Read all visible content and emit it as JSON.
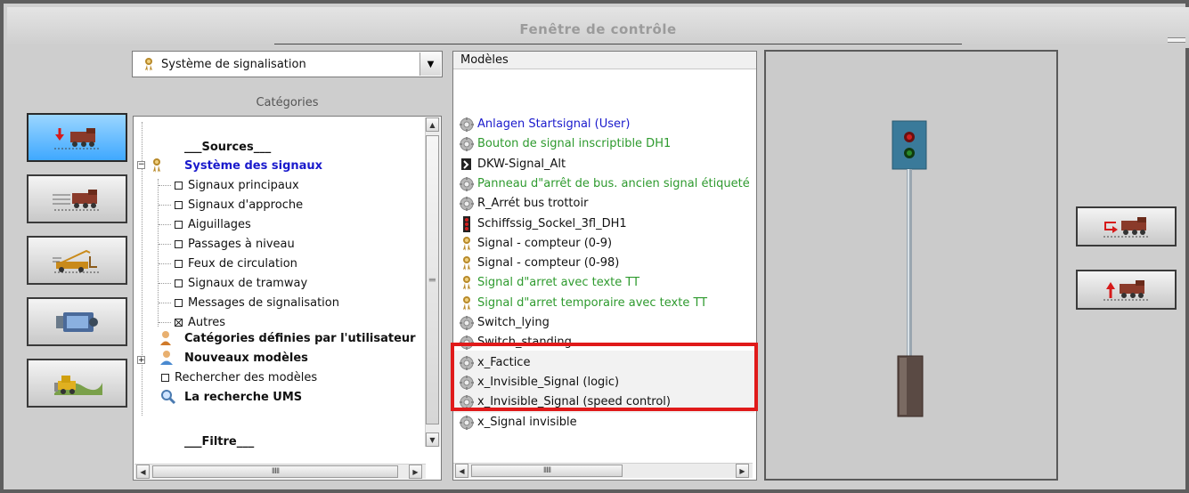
{
  "window": {
    "title": "Fenêtre de contrôle"
  },
  "combo": {
    "value": "Système de signalisation"
  },
  "categories": {
    "label": "Catégories",
    "items": [
      {
        "text": "___Sources___",
        "style": "bold"
      },
      {
        "text": "Système des signaux",
        "style": "bold-blue"
      },
      {
        "text": "Signaux principaux",
        "checkbox": true
      },
      {
        "text": "Signaux d'approche",
        "checkbox": true
      },
      {
        "text": "Aiguillages",
        "checkbox": true
      },
      {
        "text": "Passages à niveau",
        "checkbox": true
      },
      {
        "text": "Feux de circulation",
        "checkbox": true
      },
      {
        "text": "Signaux de tramway",
        "checkbox": true
      },
      {
        "text": "Messages de signalisation",
        "checkbox": true
      },
      {
        "text": "Autres",
        "checkbox": true,
        "checked": true
      },
      {
        "text": "Catégories définies par l'utilisateur",
        "style": "bold"
      },
      {
        "text": "Nouveaux modèles",
        "style": "bold"
      },
      {
        "text": "Rechercher des modèles",
        "checkbox": true
      },
      {
        "text": "La recherche UMS",
        "style": "bold"
      },
      {
        "text": "___Filtre___",
        "style": "bold"
      }
    ]
  },
  "models": {
    "header": "Modèles",
    "items": [
      {
        "text": "Anlagen Startsignal (User)",
        "color": "blue",
        "icon": "gear-icon"
      },
      {
        "text": "Bouton de signal inscriptible DH1",
        "color": "green",
        "icon": "gear-icon"
      },
      {
        "text": "DKW-Signal_Alt",
        "color": "black",
        "icon": "signal-board-icon"
      },
      {
        "text": "Panneau d\"arrêt de bus. ancien signal étiqueté",
        "color": "green",
        "icon": "gear-icon"
      },
      {
        "text": "R_Arrét bus trottoir",
        "color": "black",
        "icon": "gear-icon"
      },
      {
        "text": "Schiffssig_Sockel_3fl_DH1",
        "color": "black",
        "icon": "red-signal-icon"
      },
      {
        "text": "Signal - compteur (0-9)",
        "color": "black",
        "icon": "signal-category-icon"
      },
      {
        "text": "Signal - compteur (0-98)",
        "color": "black",
        "icon": "signal-category-icon"
      },
      {
        "text": "Signal d\"arret avec texte TT",
        "color": "green",
        "icon": "signal-category-icon"
      },
      {
        "text": "Signal d\"arret temporaire avec texte TT",
        "color": "green",
        "icon": "signal-category-icon"
      },
      {
        "text": "Switch_lying",
        "color": "black",
        "icon": "gear-icon"
      },
      {
        "text": "Switch_standing",
        "color": "black",
        "icon": "gear-icon"
      },
      {
        "text": "x_Factice",
        "color": "black",
        "icon": "gear-icon"
      },
      {
        "text": "x_Invisible_Signal (logic)",
        "color": "black",
        "icon": "gear-icon"
      },
      {
        "text": "x_Invisible_Signal (speed control)",
        "color": "black",
        "icon": "gear-icon"
      },
      {
        "text": "x_Signal invisible",
        "color": "black",
        "icon": "gear-icon"
      }
    ]
  },
  "colors": {
    "highlight": "#e01a1a",
    "accent_active": "#3fa8ff",
    "link_blue": "#1a1acc",
    "green_text": "#2e9a2e"
  }
}
